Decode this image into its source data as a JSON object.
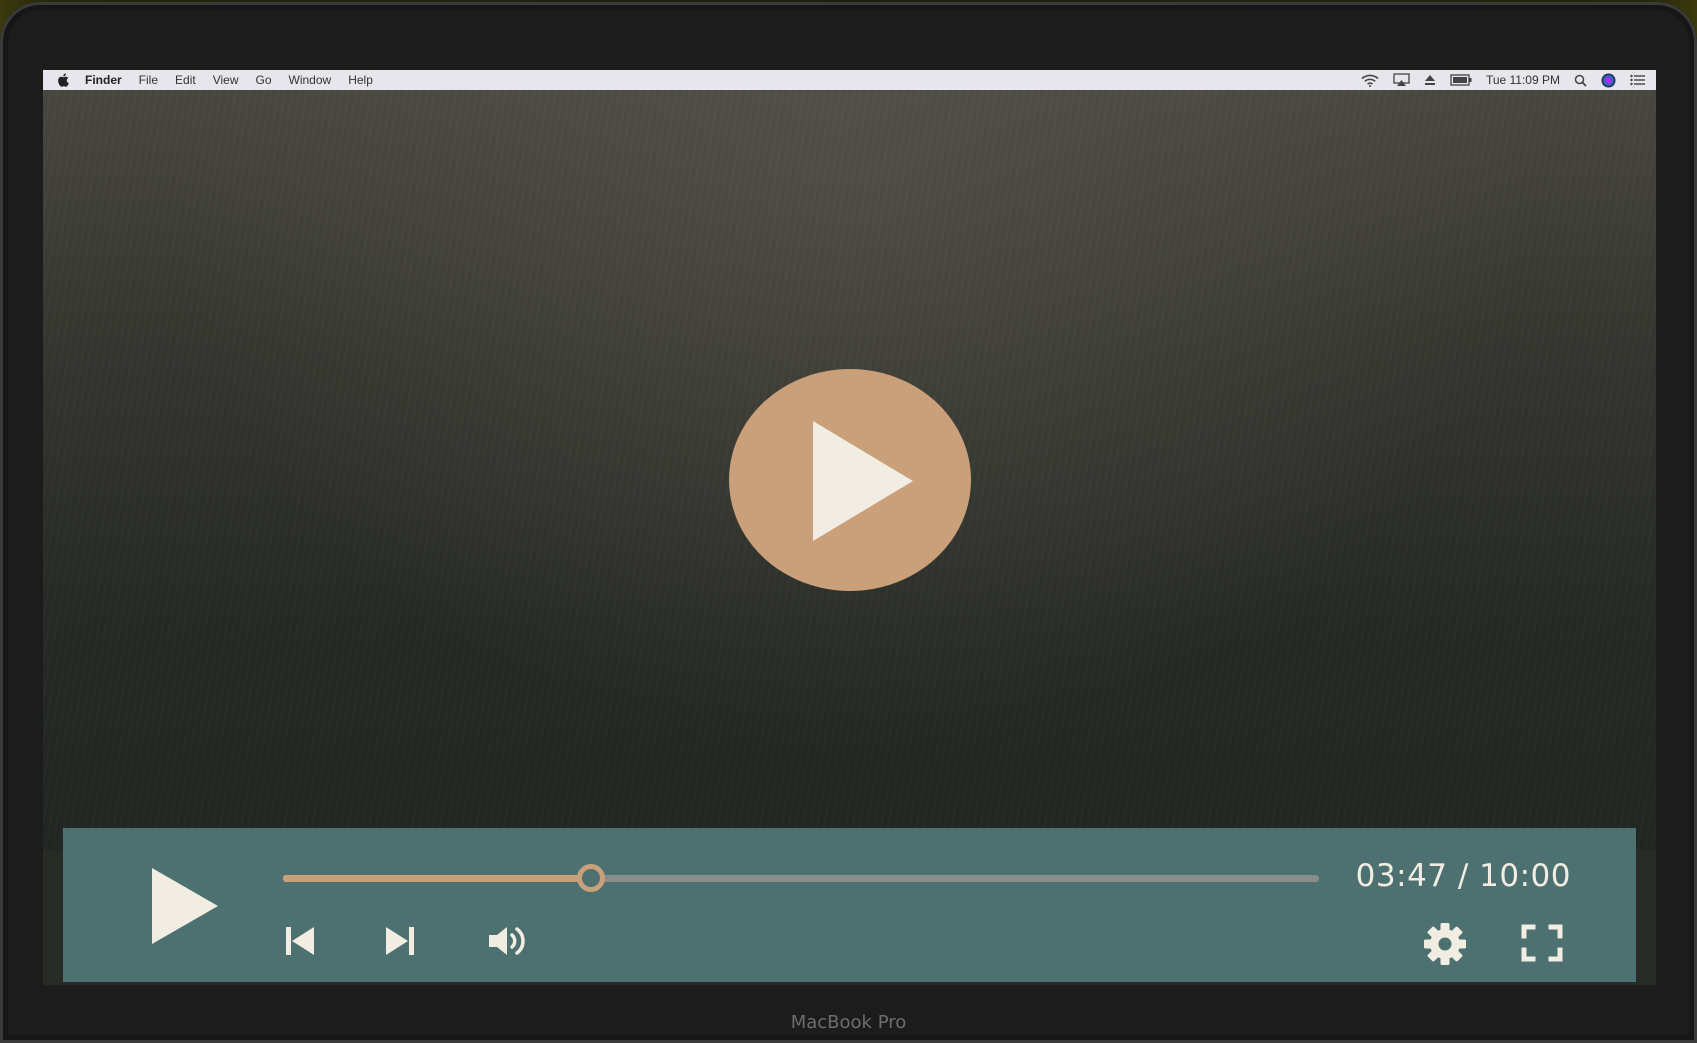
{
  "menubar": {
    "app_name": "Finder",
    "items": [
      "File",
      "Edit",
      "View",
      "Go",
      "Window",
      "Help"
    ],
    "clock": "Tue 11:09 PM",
    "status_icons": [
      "wifi-icon",
      "airplay-icon",
      "eject-icon",
      "battery-icon",
      "spotlight-search-icon",
      "siri-icon",
      "notification-center-icon"
    ]
  },
  "player": {
    "current_time": "03:47",
    "duration": "10:00",
    "time_display": "03:47 / 10:00",
    "progress_fraction": 0.297,
    "colors": {
      "accent": "#c9a07a",
      "control_bar": "#4c7170",
      "icon": "#f1ede2",
      "track": "#8a8d8a"
    },
    "icons": [
      "play-icon",
      "skip-back-icon",
      "skip-forward-icon",
      "volume-icon",
      "settings-gear-icon",
      "fullscreen-icon"
    ]
  },
  "device": {
    "label": "MacBook Pro"
  }
}
